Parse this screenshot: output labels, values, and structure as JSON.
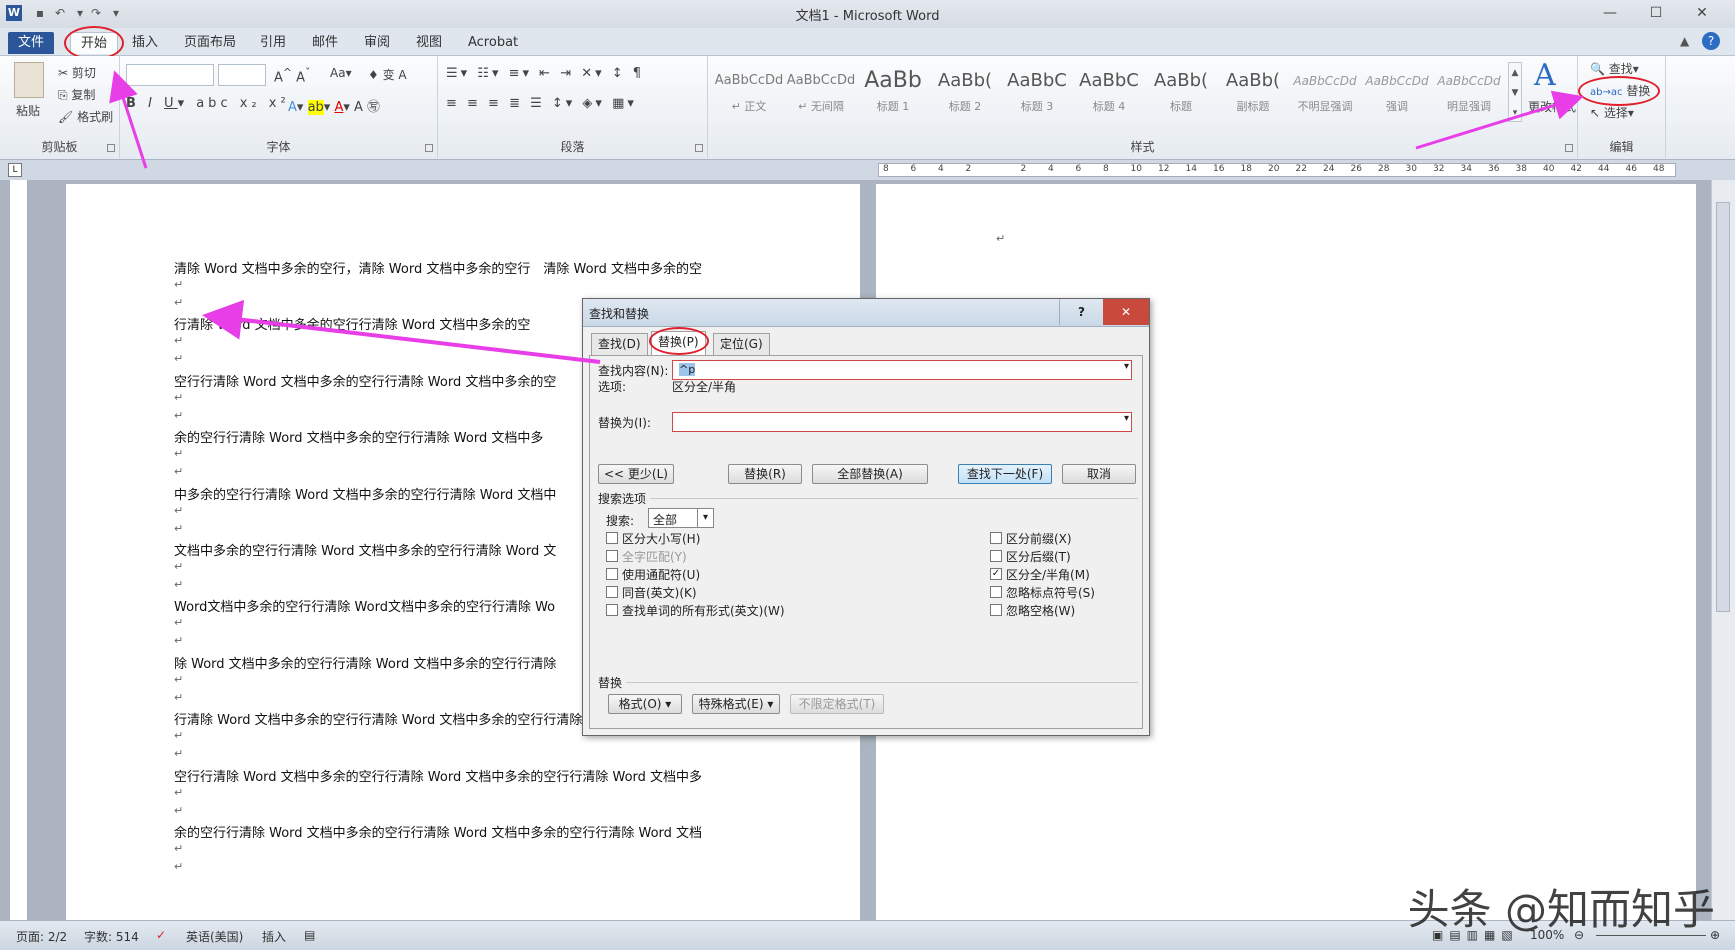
{
  "window": {
    "title": "文档1 - Microsoft Word"
  },
  "tabs": [
    "文件",
    "开始",
    "插入",
    "页面布局",
    "引用",
    "邮件",
    "审阅",
    "视图",
    "Acrobat"
  ],
  "ribbon": {
    "clipboard": {
      "paste": "粘贴",
      "cut": "剪切",
      "copy": "复制",
      "format_painter": "格式刷",
      "label": "剪贴板"
    },
    "font": {
      "label": "字体"
    },
    "paragraph": {
      "label": "段落"
    },
    "styles": {
      "label": "样式",
      "items": [
        {
          "sample": "AaBbCcDd",
          "name": "↵ 正文"
        },
        {
          "sample": "AaBbCcDd",
          "name": "↵ 无间隔"
        },
        {
          "sample": "AaBb",
          "name": "标题 1"
        },
        {
          "sample": "AaBb(",
          "name": "标题 2"
        },
        {
          "sample": "AaBbC",
          "name": "标题 3"
        },
        {
          "sample": "AaBbC",
          "name": "标题 4"
        },
        {
          "sample": "AaBb(",
          "name": "标题"
        },
        {
          "sample": "AaBb(",
          "name": "副标题"
        },
        {
          "sample": "AaBbCcDd",
          "name": "不明显强调"
        },
        {
          "sample": "AaBbCcDd",
          "name": "强调"
        },
        {
          "sample": "AaBbCcDd",
          "name": "明显强调"
        }
      ],
      "change": "更改样式"
    },
    "editing": {
      "find": "查找",
      "replace": "替换",
      "select": "选择",
      "label": "编辑"
    }
  },
  "ruler_ticks": [
    "8",
    "6",
    "4",
    "2",
    "",
    "2",
    "4",
    "6",
    "8",
    "10",
    "12",
    "14",
    "16",
    "18",
    "20",
    "22",
    "24",
    "26",
    "28",
    "30",
    "32",
    "34",
    "36",
    "38",
    "40",
    "42",
    "44",
    "46",
    "48"
  ],
  "document": {
    "lines": [
      "清除 Word 文档中多余的空行，清除 Word 文档中多余的空行　清除 Word 文档中多余的空",
      "行清除 Word 文档中多余的空行行清除 Word 文档中多余的空",
      "空行行清除 Word 文档中多余的空行行清除 Word 文档中多余的空",
      "余的空行行清除 Word 文档中多余的空行行清除 Word 文档中多",
      "中多余的空行行清除 Word 文档中多余的空行行清除 Word 文档中",
      "文档中多余的空行行清除 Word 文档中多余的空行行清除 Word 文",
      "Word文档中多余的空行行清除 Word文档中多余的空行行清除 Wo",
      "除 Word 文档中多余的空行行清除 Word 文档中多余的空行行清除",
      "行清除 Word 文档中多余的空行行清除 Word 文档中多余的空行行清除 Word 文档中多余的",
      "空行行清除 Word 文档中多余的空行行清除 Word 文档中多余的空行行清除 Word 文档中多",
      "余的空行行清除 Word 文档中多余的空行行清除 Word 文档中多余的空行行清除 Word 文档"
    ],
    "para_mark": "↵"
  },
  "dialog": {
    "title": "查找和替换",
    "help": "?",
    "close": "✕",
    "tabs": [
      "查找(D)",
      "替换(P)",
      "定位(G)"
    ],
    "find_label": "查找内容(N):",
    "find_value": "^p",
    "options_label": "选项:",
    "options_value": "区分全/半角",
    "replace_label": "替换为(I):",
    "replace_value": "",
    "buttons": {
      "less": "<< 更少(L)",
      "replace": "替换(R)",
      "replace_all": "全部替换(A)",
      "find_next": "查找下一处(F)",
      "cancel": "取消"
    },
    "search_options_label": "搜索选项",
    "search_label": "搜索:",
    "search_value": "全部",
    "left_checks": [
      {
        "label": "区分大小写(H)",
        "checked": false,
        "disabled": false
      },
      {
        "label": "全字匹配(Y)",
        "checked": false,
        "disabled": true
      },
      {
        "label": "使用通配符(U)",
        "checked": false,
        "disabled": false
      },
      {
        "label": "同音(英文)(K)",
        "checked": false,
        "disabled": false
      },
      {
        "label": "查找单词的所有形式(英文)(W)",
        "checked": false,
        "disabled": false
      }
    ],
    "right_checks": [
      {
        "label": "区分前缀(X)",
        "checked": false
      },
      {
        "label": "区分后缀(T)",
        "checked": false
      },
      {
        "label": "区分全/半角(M)",
        "checked": true
      },
      {
        "label": "忽略标点符号(S)",
        "checked": false
      },
      {
        "label": "忽略空格(W)",
        "checked": false
      }
    ],
    "replace_section_label": "替换",
    "format_btn": "格式(O) ▾",
    "special_btn": "特殊格式(E) ▾",
    "no_format_btn": "不限定格式(T)"
  },
  "status": {
    "page": "页面: 2/2",
    "words": "字数: 514",
    "lang": "英语(美国)",
    "mode": "插入",
    "zoom": "100%"
  },
  "watermark": "头条 @知而知乎",
  "colors": {
    "file_tab": "#2b579a",
    "annotation": "#e0202c",
    "arrow": "#e83ee8"
  }
}
